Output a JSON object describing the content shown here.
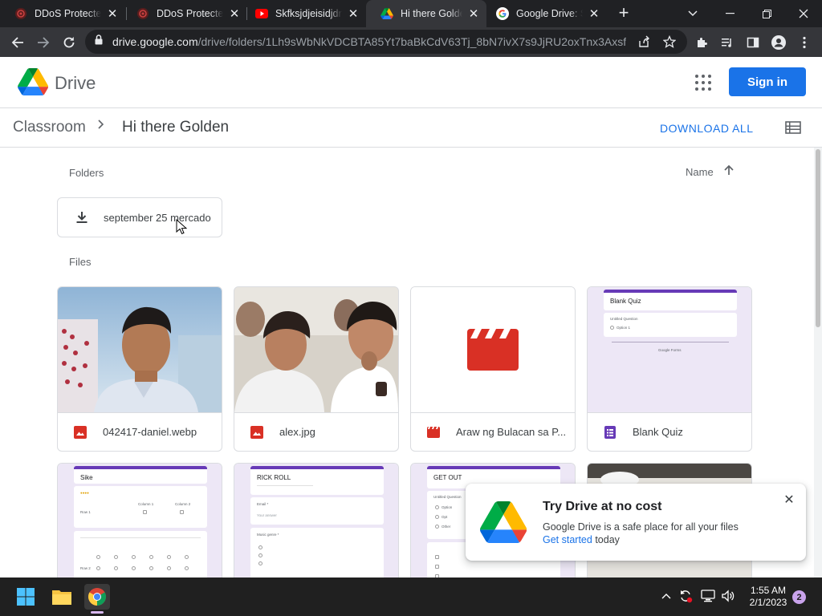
{
  "browser": {
    "tabs": [
      {
        "title": "DDoS Protected",
        "icon": "ddos-favicon",
        "active": false
      },
      {
        "title": "DDoS Protected",
        "icon": "ddos-favicon",
        "active": false
      },
      {
        "title": "Skfksjdjeisidjdnd",
        "icon": "youtube-favicon",
        "active": false
      },
      {
        "title": "Hi there Golden",
        "icon": "drive-favicon",
        "active": true
      },
      {
        "title": "Google Drive: Si",
        "icon": "google-favicon",
        "active": false
      }
    ],
    "address_host": "drive.google.com",
    "address_path": "/drive/folders/1Lh9sWbNkVDCBTA85Yt7baBkCdV63Tj_8bN7ivX7s9JjRU2oxTnx3AxsfP..."
  },
  "drive": {
    "app_name": "Drive",
    "sign_in_label": "Sign in",
    "breadcrumb": {
      "parent": "Classroom",
      "current": "Hi there Golden"
    },
    "download_all_label": "DOWNLOAD ALL",
    "folders_label": "Folders",
    "files_label": "Files",
    "sort_label": "Name",
    "folders": [
      {
        "name": "september 25 mercado"
      }
    ],
    "files": [
      {
        "name": "042417-daniel.webp",
        "type": "image"
      },
      {
        "name": "alex.jpg",
        "type": "image"
      },
      {
        "name": "Araw ng Bulacan sa P...",
        "type": "video"
      },
      {
        "name": "Blank Quiz",
        "type": "form"
      }
    ],
    "form_thumbs": {
      "blank_quiz": {
        "title": "Blank Quiz",
        "line1": "Untitled Question",
        "line2": "Option 1",
        "footer": "Google Forms"
      },
      "sike": {
        "title": "Sike",
        "col1": "Column 1",
        "col2": "Column 2",
        "row1": "Row 1",
        "row2": "Row 2"
      },
      "rick": {
        "title": "RICK ROLL",
        "q1": "Email *",
        "q2": "Your answer",
        "q3": "Music genre *"
      },
      "getout": {
        "title": "GET OUT",
        "q1": "Untitled Question",
        "opt1": "Option",
        "opt2": "Opt",
        "opt3": "Other"
      }
    }
  },
  "promo": {
    "title": "Try Drive at no cost",
    "line1": "Google Drive is a safe place for all your files",
    "link_text": "Get started",
    "line2_rest": " today"
  },
  "taskbar": {
    "time": "1:55 AM",
    "date": "2/1/2023",
    "notification_count": "2"
  },
  "colors": {
    "accent_blue": "#1a73e8",
    "form_purple": "#673ab7",
    "file_red": "#d93025",
    "chrome_dark": "#202124"
  }
}
